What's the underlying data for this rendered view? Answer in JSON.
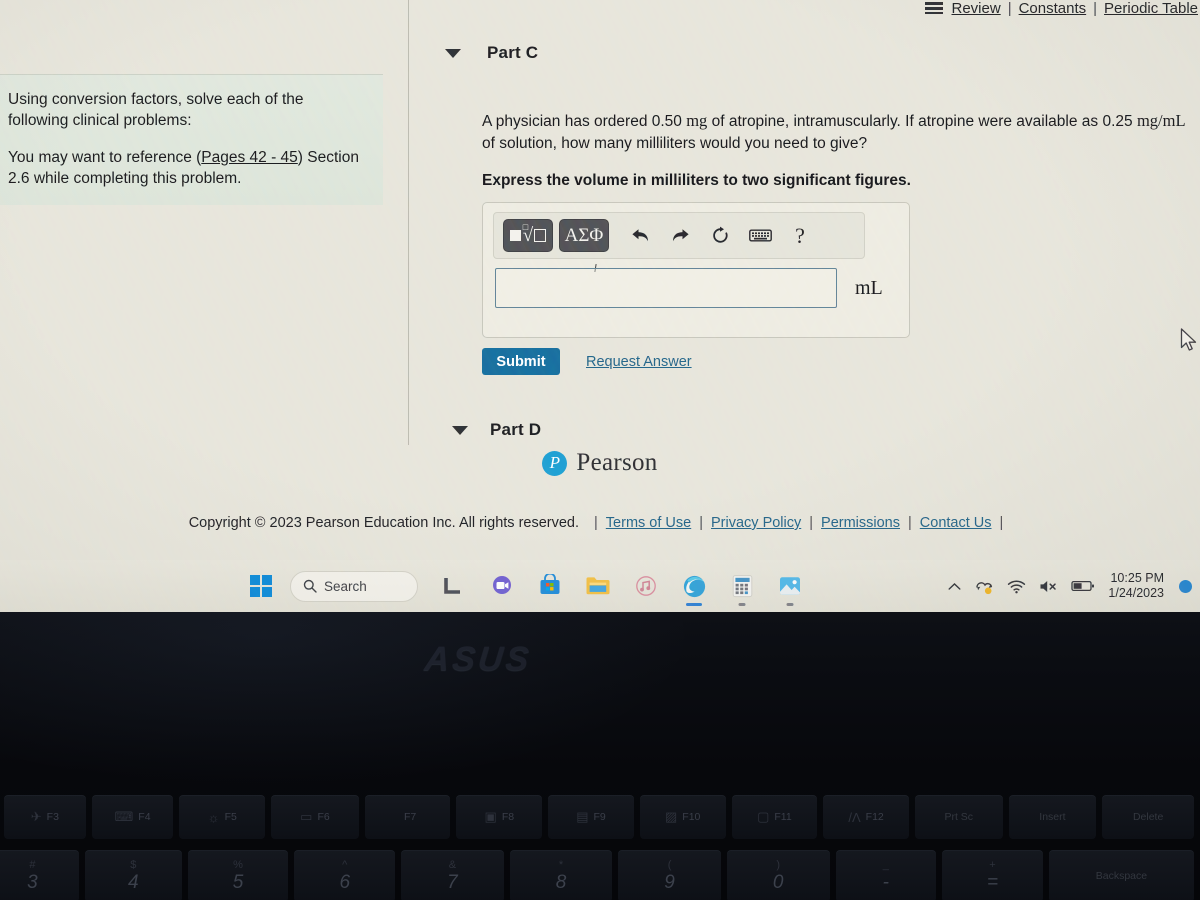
{
  "topbar": {
    "menu_icon": "hamburger-icon",
    "links": [
      "Review",
      "Constants",
      "Periodic Table"
    ],
    "separator": "|"
  },
  "info_panel": {
    "paragraph1": "Using conversion factors, solve each of the following clinical problems:",
    "paragraph2_before": "You may want to reference (",
    "paragraph2_link": "Pages 42 - 45",
    "paragraph2_after": ") Section 2.6 while completing this problem."
  },
  "part_c": {
    "title": "Part C",
    "caret": "chevron-down-icon",
    "question_line1": "A physician has ordered 0.50 ",
    "question_unit1": "mg",
    "question_line2": " of atropine, intramuscularly. If atropine were available as 0.25 ",
    "question_unit2": "mg/mL",
    "question_line3": " of solution, how many milliliters would you need to give?",
    "prompt": "Express the volume in milliliters to two significant figures.",
    "answer_value": "",
    "answer_placeholder": "",
    "answer_unit": "mL",
    "toolbar": {
      "template_button": "math-template-button",
      "template_radical": "√",
      "greek_button": "ΑΣΦ",
      "undo": "undo-icon",
      "redo": "redo-icon",
      "reset": "reset-icon",
      "keyboard": "keyboard-icon",
      "help": "?"
    },
    "submit_label": "Submit",
    "request_answer_label": "Request Answer"
  },
  "part_d": {
    "title": "Part D",
    "caret": "chevron-down-icon"
  },
  "footer": {
    "brand_mark": "P",
    "brand_name": "Pearson",
    "copyright": "Copyright © 2023 Pearson Education Inc. All rights reserved.",
    "links": [
      "Terms of Use",
      "Privacy Policy",
      "Permissions",
      "Contact Us"
    ],
    "separator": "|"
  },
  "taskbar": {
    "start": "windows-start-icon",
    "search_label": "Search",
    "search_icon": "search-icon",
    "apps": [
      {
        "name": "task-view-icon"
      },
      {
        "name": "chat-teams-icon"
      },
      {
        "name": "microsoft-store-icon"
      },
      {
        "name": "file-explorer-icon"
      },
      {
        "name": "music-icon"
      },
      {
        "name": "microsoft-edge-icon"
      },
      {
        "name": "calculator-icon"
      },
      {
        "name": "photos-icon"
      }
    ],
    "tray": {
      "chevron": "chevron-up-icon",
      "onedrive": "onedrive-sync-icon",
      "wifi": "wifi-icon",
      "volume": "volume-muted-icon",
      "battery": "battery-icon",
      "time": "10:25 PM",
      "date": "1/24/2023"
    }
  },
  "laptop": {
    "brand": "ASUS",
    "function_keys": [
      {
        "glyph": "✈",
        "label": "F3"
      },
      {
        "glyph": "⌨",
        "label": "F4"
      },
      {
        "glyph": "☼",
        "label": "F5"
      },
      {
        "glyph": "▭",
        "label": "F6"
      },
      {
        "glyph": "",
        "label": "F7"
      },
      {
        "glyph": "▣",
        "label": "F8"
      },
      {
        "glyph": "▤",
        "label": "F9"
      },
      {
        "glyph": "▨",
        "label": "F10"
      },
      {
        "glyph": "▢",
        "label": "F11"
      },
      {
        "glyph": "/Λ",
        "label": "F12"
      },
      {
        "glyph": "",
        "label": "Prt Sc"
      },
      {
        "glyph": "",
        "label": "Insert"
      },
      {
        "glyph": "",
        "label": "Delete"
      }
    ],
    "number_keys": [
      {
        "sym": "#",
        "dig": "3"
      },
      {
        "sym": "$",
        "dig": "4"
      },
      {
        "sym": "%",
        "dig": "5"
      },
      {
        "sym": "^",
        "dig": "6"
      },
      {
        "sym": "&",
        "dig": "7"
      },
      {
        "sym": "*",
        "dig": "8"
      },
      {
        "sym": "(",
        "dig": "9"
      },
      {
        "sym": ")",
        "dig": "0"
      },
      {
        "sym": "_",
        "dig": "-"
      },
      {
        "sym": "+",
        "dig": "="
      }
    ],
    "backspace_label": "Backspace"
  },
  "cursor": {
    "name": "mouse-pointer"
  },
  "colors": {
    "submit_blue": "#14699c",
    "link_blue": "#1f5f86",
    "pearson_blue": "#1b9bd1",
    "panel_green": "#dfe6dc",
    "screen_bg": "#e6e4da"
  }
}
